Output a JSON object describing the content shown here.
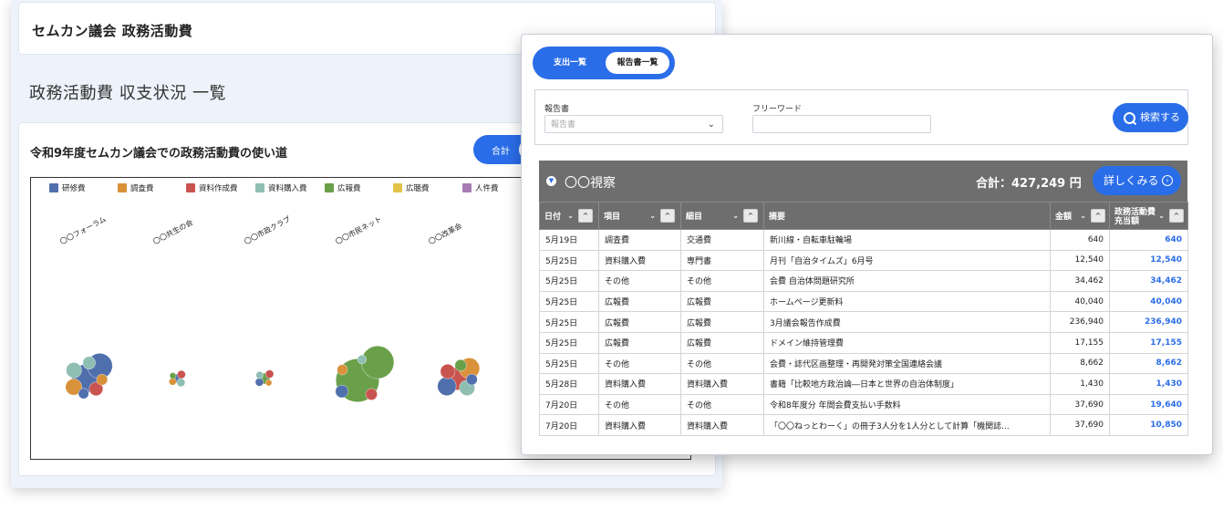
{
  "back_window": {
    "app_title": "セムカン議会 政務活動費",
    "page_heading": "政務活動費 収支状況 一覧",
    "chart_card": {
      "title": "令和9年度セムカン議会での政務活動費の使い道",
      "toggle_label": "合計"
    }
  },
  "chart_data": {
    "type": "scatter",
    "title": "",
    "legend_placement": "top",
    "legend": [
      {
        "name": "研修費",
        "color": "#4f6fad"
      },
      {
        "name": "調査費",
        "color": "#d9923a"
      },
      {
        "name": "資料作成費",
        "color": "#c9544f"
      },
      {
        "name": "資料購入費",
        "color": "#8fbfb3"
      },
      {
        "name": "広報費",
        "color": "#6aa04a"
      },
      {
        "name": "広聴費",
        "color": "#e3c24a"
      },
      {
        "name": "人件費",
        "color": "#a77cb5"
      }
    ],
    "categories": [
      "〇〇フォーラム",
      "〇〇共生の会",
      "〇〇市政クラブ",
      "〇〇市民ネット",
      "〇〇改革会"
    ],
    "groups": [
      {
        "category": "〇〇フォーラム",
        "bubbles": [
          {
            "color": "#4f6fad",
            "value": 60
          },
          {
            "color": "#4f6fad",
            "value": 48
          },
          {
            "color": "#d9923a",
            "value": 20
          },
          {
            "color": "#c9544f",
            "value": 14
          },
          {
            "color": "#8fbfb3",
            "value": 18
          },
          {
            "color": "#8fbfb3",
            "value": 12
          },
          {
            "color": "#d9923a",
            "value": 9
          },
          {
            "color": "#4f6fad",
            "value": 8
          }
        ]
      },
      {
        "category": "〇〇共生の会",
        "bubbles": [
          {
            "color": "#4f6fad",
            "value": 6
          },
          {
            "color": "#c9544f",
            "value": 5
          },
          {
            "color": "#d9923a",
            "value": 4
          },
          {
            "color": "#8fbfb3",
            "value": 5
          },
          {
            "color": "#6aa04a",
            "value": 3
          }
        ]
      },
      {
        "category": "〇〇市政クラブ",
        "bubbles": [
          {
            "color": "#6aa04a",
            "value": 9
          },
          {
            "color": "#c9544f",
            "value": 5
          },
          {
            "color": "#4f6fad",
            "value": 5
          },
          {
            "color": "#d9923a",
            "value": 3
          },
          {
            "color": "#8fbfb3",
            "value": 4
          }
        ]
      },
      {
        "category": "〇〇市民ネット",
        "bubbles": [
          {
            "color": "#6aa04a",
            "value": 140
          },
          {
            "color": "#6aa04a",
            "value": 80
          },
          {
            "color": "#4f6fad",
            "value": 12
          },
          {
            "color": "#c9544f",
            "value": 10
          },
          {
            "color": "#d9923a",
            "value": 8
          },
          {
            "color": "#8fbfb3",
            "value": 6
          }
        ]
      },
      {
        "category": "〇〇改革会",
        "bubbles": [
          {
            "color": "#c9544f",
            "value": 40
          },
          {
            "color": "#d9923a",
            "value": 32
          },
          {
            "color": "#4f6fad",
            "value": 26
          },
          {
            "color": "#8fbfb3",
            "value": 18
          },
          {
            "color": "#c9544f",
            "value": 16
          },
          {
            "color": "#6aa04a",
            "value": 10
          },
          {
            "color": "#4f6fad",
            "value": 9
          }
        ]
      }
    ]
  },
  "front_window": {
    "tabs": [
      {
        "label": "支出一覧"
      },
      {
        "label": "報告書一覧"
      }
    ],
    "filters": {
      "report_label": "報告書",
      "report_placeholder": "報告書",
      "keyword_label": "フリーワード",
      "keyword_value": "",
      "search_label": "検索する"
    },
    "group": {
      "title": "〇〇視察",
      "total": "合計：427,249 円",
      "detail_label": "詳しくみる"
    },
    "table": {
      "headers": [
        "日付",
        "項目",
        "細目",
        "摘要",
        "金額",
        "政務活動費",
        "充当額"
      ],
      "rows": [
        [
          "5月19日",
          "調査費",
          "交通費",
          "新川線・自転車駐輪場",
          "640",
          "640"
        ],
        [
          "5月25日",
          "資料購入費",
          "専門書",
          "月刊「自治タイムズ」6月号",
          "12,540",
          "12,540"
        ],
        [
          "5月25日",
          "その他",
          "その他",
          "会費 自治体問題研究所",
          "34,462",
          "34,462"
        ],
        [
          "5月25日",
          "広報費",
          "広報費",
          "ホームページ更新料",
          "40,040",
          "40,040"
        ],
        [
          "5月25日",
          "広報費",
          "広報費",
          "3月議会報告作成費",
          "236,940",
          "236,940"
        ],
        [
          "5月25日",
          "広報費",
          "広報費",
          "ドメイン維持管理費",
          "17,155",
          "17,155"
        ],
        [
          "5月25日",
          "その他",
          "その他",
          "会費・誌代区画整理・再開発対策全国連絡会議",
          "8,662",
          "8,662"
        ],
        [
          "5月28日",
          "資料購入費",
          "資料購入費",
          "書籍「比較地方政治論―日本と世界の自治体制度」",
          "1,430",
          "1,430"
        ],
        [
          "7月20日",
          "その他",
          "その他",
          "令和8年度分 年間会費支払い手数料",
          "37,690",
          "19,640"
        ],
        [
          "7月20日",
          "資料購入費",
          "資料購入費",
          "「〇〇ねっとわーく」の冊子3人分を1人分として計算「機関誌...",
          "37,690",
          "10,850"
        ]
      ]
    }
  }
}
